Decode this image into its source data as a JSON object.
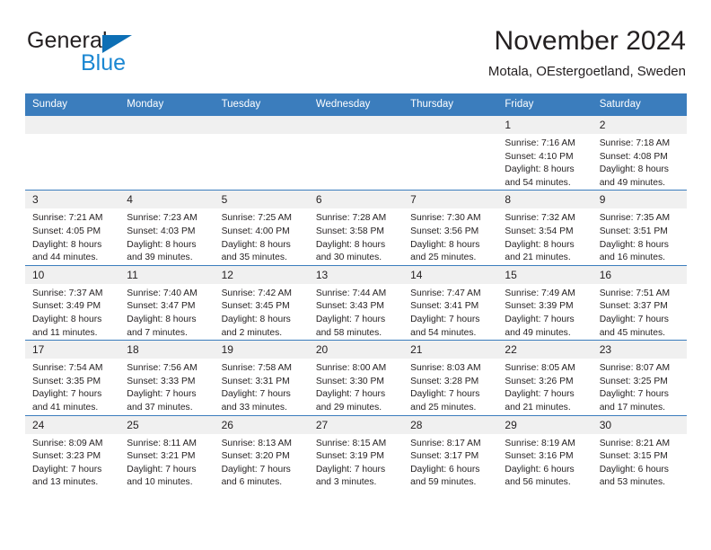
{
  "brand": {
    "name_part1": "General",
    "name_part2": "Blue",
    "triangle_color": "#0d6fb5",
    "blue_text_color": "#1b87d2"
  },
  "header": {
    "title": "November 2024",
    "subtitle": "Motala, OEstergoetland, Sweden",
    "accent_color": "#3b7dbd",
    "daynum_band_color": "#f0f0f0"
  },
  "weekdays": [
    "Sunday",
    "Monday",
    "Tuesday",
    "Wednesday",
    "Thursday",
    "Friday",
    "Saturday"
  ],
  "weeks": [
    [
      {
        "day": "",
        "lines": []
      },
      {
        "day": "",
        "lines": []
      },
      {
        "day": "",
        "lines": []
      },
      {
        "day": "",
        "lines": []
      },
      {
        "day": "",
        "lines": []
      },
      {
        "day": "1",
        "lines": [
          "Sunrise: 7:16 AM",
          "Sunset: 4:10 PM",
          "Daylight: 8 hours",
          "and 54 minutes."
        ]
      },
      {
        "day": "2",
        "lines": [
          "Sunrise: 7:18 AM",
          "Sunset: 4:08 PM",
          "Daylight: 8 hours",
          "and 49 minutes."
        ]
      }
    ],
    [
      {
        "day": "3",
        "lines": [
          "Sunrise: 7:21 AM",
          "Sunset: 4:05 PM",
          "Daylight: 8 hours",
          "and 44 minutes."
        ]
      },
      {
        "day": "4",
        "lines": [
          "Sunrise: 7:23 AM",
          "Sunset: 4:03 PM",
          "Daylight: 8 hours",
          "and 39 minutes."
        ]
      },
      {
        "day": "5",
        "lines": [
          "Sunrise: 7:25 AM",
          "Sunset: 4:00 PM",
          "Daylight: 8 hours",
          "and 35 minutes."
        ]
      },
      {
        "day": "6",
        "lines": [
          "Sunrise: 7:28 AM",
          "Sunset: 3:58 PM",
          "Daylight: 8 hours",
          "and 30 minutes."
        ]
      },
      {
        "day": "7",
        "lines": [
          "Sunrise: 7:30 AM",
          "Sunset: 3:56 PM",
          "Daylight: 8 hours",
          "and 25 minutes."
        ]
      },
      {
        "day": "8",
        "lines": [
          "Sunrise: 7:32 AM",
          "Sunset: 3:54 PM",
          "Daylight: 8 hours",
          "and 21 minutes."
        ]
      },
      {
        "day": "9",
        "lines": [
          "Sunrise: 7:35 AM",
          "Sunset: 3:51 PM",
          "Daylight: 8 hours",
          "and 16 minutes."
        ]
      }
    ],
    [
      {
        "day": "10",
        "lines": [
          "Sunrise: 7:37 AM",
          "Sunset: 3:49 PM",
          "Daylight: 8 hours",
          "and 11 minutes."
        ]
      },
      {
        "day": "11",
        "lines": [
          "Sunrise: 7:40 AM",
          "Sunset: 3:47 PM",
          "Daylight: 8 hours",
          "and 7 minutes."
        ]
      },
      {
        "day": "12",
        "lines": [
          "Sunrise: 7:42 AM",
          "Sunset: 3:45 PM",
          "Daylight: 8 hours",
          "and 2 minutes."
        ]
      },
      {
        "day": "13",
        "lines": [
          "Sunrise: 7:44 AM",
          "Sunset: 3:43 PM",
          "Daylight: 7 hours",
          "and 58 minutes."
        ]
      },
      {
        "day": "14",
        "lines": [
          "Sunrise: 7:47 AM",
          "Sunset: 3:41 PM",
          "Daylight: 7 hours",
          "and 54 minutes."
        ]
      },
      {
        "day": "15",
        "lines": [
          "Sunrise: 7:49 AM",
          "Sunset: 3:39 PM",
          "Daylight: 7 hours",
          "and 49 minutes."
        ]
      },
      {
        "day": "16",
        "lines": [
          "Sunrise: 7:51 AM",
          "Sunset: 3:37 PM",
          "Daylight: 7 hours",
          "and 45 minutes."
        ]
      }
    ],
    [
      {
        "day": "17",
        "lines": [
          "Sunrise: 7:54 AM",
          "Sunset: 3:35 PM",
          "Daylight: 7 hours",
          "and 41 minutes."
        ]
      },
      {
        "day": "18",
        "lines": [
          "Sunrise: 7:56 AM",
          "Sunset: 3:33 PM",
          "Daylight: 7 hours",
          "and 37 minutes."
        ]
      },
      {
        "day": "19",
        "lines": [
          "Sunrise: 7:58 AM",
          "Sunset: 3:31 PM",
          "Daylight: 7 hours",
          "and 33 minutes."
        ]
      },
      {
        "day": "20",
        "lines": [
          "Sunrise: 8:00 AM",
          "Sunset: 3:30 PM",
          "Daylight: 7 hours",
          "and 29 minutes."
        ]
      },
      {
        "day": "21",
        "lines": [
          "Sunrise: 8:03 AM",
          "Sunset: 3:28 PM",
          "Daylight: 7 hours",
          "and 25 minutes."
        ]
      },
      {
        "day": "22",
        "lines": [
          "Sunrise: 8:05 AM",
          "Sunset: 3:26 PM",
          "Daylight: 7 hours",
          "and 21 minutes."
        ]
      },
      {
        "day": "23",
        "lines": [
          "Sunrise: 8:07 AM",
          "Sunset: 3:25 PM",
          "Daylight: 7 hours",
          "and 17 minutes."
        ]
      }
    ],
    [
      {
        "day": "24",
        "lines": [
          "Sunrise: 8:09 AM",
          "Sunset: 3:23 PM",
          "Daylight: 7 hours",
          "and 13 minutes."
        ]
      },
      {
        "day": "25",
        "lines": [
          "Sunrise: 8:11 AM",
          "Sunset: 3:21 PM",
          "Daylight: 7 hours",
          "and 10 minutes."
        ]
      },
      {
        "day": "26",
        "lines": [
          "Sunrise: 8:13 AM",
          "Sunset: 3:20 PM",
          "Daylight: 7 hours",
          "and 6 minutes."
        ]
      },
      {
        "day": "27",
        "lines": [
          "Sunrise: 8:15 AM",
          "Sunset: 3:19 PM",
          "Daylight: 7 hours",
          "and 3 minutes."
        ]
      },
      {
        "day": "28",
        "lines": [
          "Sunrise: 8:17 AM",
          "Sunset: 3:17 PM",
          "Daylight: 6 hours",
          "and 59 minutes."
        ]
      },
      {
        "day": "29",
        "lines": [
          "Sunrise: 8:19 AM",
          "Sunset: 3:16 PM",
          "Daylight: 6 hours",
          "and 56 minutes."
        ]
      },
      {
        "day": "30",
        "lines": [
          "Sunrise: 8:21 AM",
          "Sunset: 3:15 PM",
          "Daylight: 6 hours",
          "and 53 minutes."
        ]
      }
    ]
  ]
}
